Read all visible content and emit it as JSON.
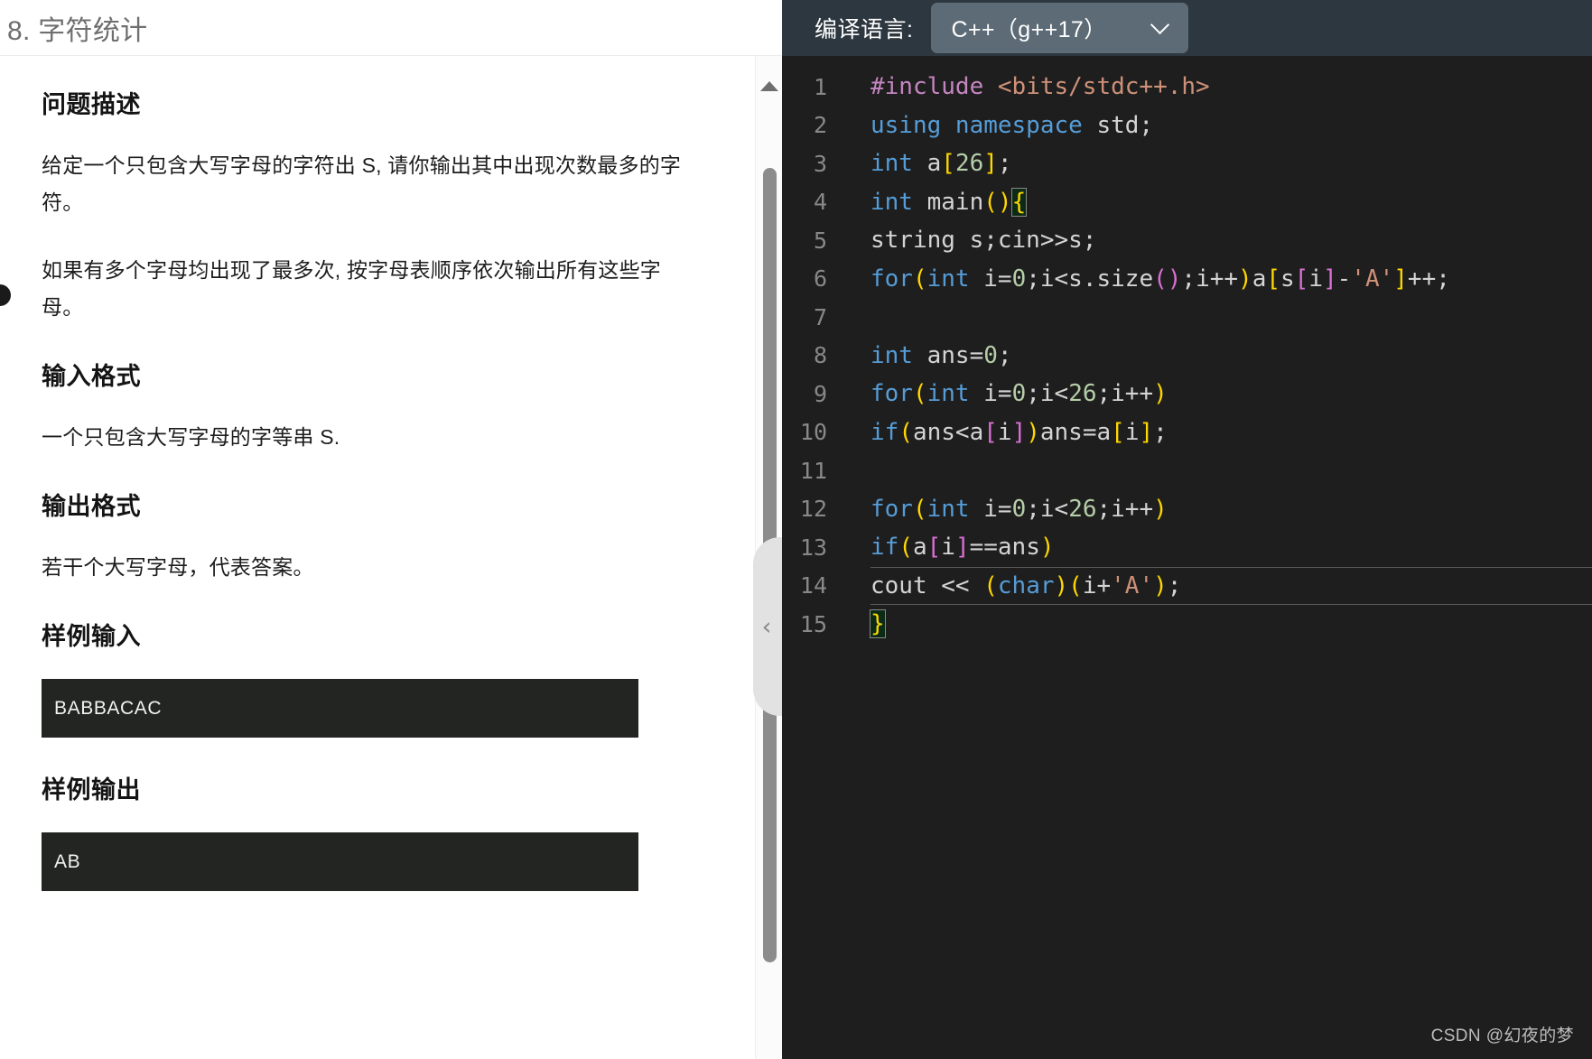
{
  "problem": {
    "title": "8. 字符统计",
    "sections": [
      {
        "heading": "问题描述",
        "paragraphs": [
          "给定一个只包含大写字母的字符出 S, 请你输出其中出现次数最多的字符。",
          "如果有多个字母均出现了最多次, 按字母表顺序依次输出所有这些字母。"
        ]
      },
      {
        "heading": "输入格式",
        "paragraphs": [
          "一个只包含大写字母的字等串 S."
        ]
      },
      {
        "heading": "输出格式",
        "paragraphs": [
          "若干个大写字母，代表答案。"
        ]
      },
      {
        "heading": "样例输入",
        "sample": "BABBACAC"
      },
      {
        "heading": "样例输出",
        "sample": "AB"
      }
    ],
    "math_var": "S"
  },
  "editor": {
    "language_label": "编译语言:",
    "language_value": "C++（g++17）",
    "chevron_icon": "chevron-down-icon",
    "lines": [
      {
        "no": "1",
        "text": "#include <bits/stdc++.h>"
      },
      {
        "no": "2",
        "text": "using namespace std;"
      },
      {
        "no": "3",
        "text": "int a[26];"
      },
      {
        "no": "4",
        "text": "int main(){"
      },
      {
        "no": "5",
        "text": "string s;cin>>s;"
      },
      {
        "no": "6",
        "text": "for(int i=0;i<s.size();i++)a[s[i]-'A']++;"
      },
      {
        "no": "7",
        "text": ""
      },
      {
        "no": "8",
        "text": "int ans=0;"
      },
      {
        "no": "9",
        "text": "for(int i=0;i<26;i++)"
      },
      {
        "no": "10",
        "text": "if(ans<a[i])ans=a[i];"
      },
      {
        "no": "11",
        "text": ""
      },
      {
        "no": "12",
        "text": "for(int i=0;i<26;i++)"
      },
      {
        "no": "13",
        "text": "if(a[i]==ans)"
      },
      {
        "no": "14",
        "text": "cout << (char)(i+'A');"
      },
      {
        "no": "15",
        "text": "}"
      }
    ],
    "active_line_no": "14"
  },
  "scrollbar": {
    "up_arrow_icon": "scroll-up-arrow-icon",
    "collapse_icon": "chevron-left-icon"
  },
  "watermark": "CSDN @幻夜的梦",
  "colors": {
    "editor_bg": "#1e1e1e",
    "header_bg": "#2d3740",
    "select_bg": "#5c6b76",
    "sample_bg": "#222521"
  }
}
